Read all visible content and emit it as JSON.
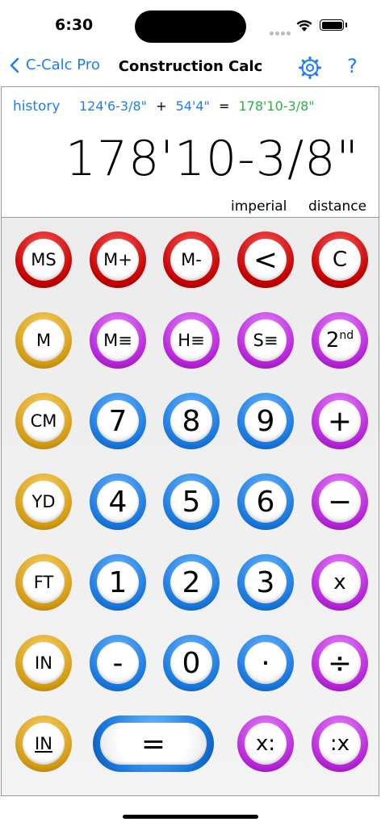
{
  "status": {
    "time": "6:30"
  },
  "nav": {
    "back_label": "C-Calc Pro",
    "title": "Construction Calc",
    "help_label": "?"
  },
  "display": {
    "history_label": "history",
    "operand1": "124'6-3/8\"",
    "operator": "+",
    "operand2": "54'4\"",
    "equals": "=",
    "result_small": "178'10-3/8\"",
    "main_value": "178'10-3/8\"",
    "mode_units": "imperial",
    "mode_type": "distance"
  },
  "keys": {
    "ms": "MS",
    "mplus": "M+",
    "mminus": "M-",
    "back": "<",
    "clear": "C",
    "m": "M",
    "mlist": "M≡",
    "hlist": "H≡",
    "slist": "S≡",
    "second": "2",
    "second_sup": "nd",
    "cm": "CM",
    "k7": "7",
    "k8": "8",
    "k9": "9",
    "plus": "+",
    "yd": "YD",
    "k4": "4",
    "k5": "5",
    "k6": "6",
    "minus": "−",
    "ft": "FT",
    "k1": "1",
    "k2": "2",
    "k3": "3",
    "times": "x",
    "in": "IN",
    "neg": "-",
    "k0": "0",
    "dot": "·",
    "divide": "÷",
    "in_frac": "IN",
    "equals": "=",
    "xcolon": "x:",
    "colonx": ":x"
  },
  "colors": {
    "accent": "#1a7ef2",
    "result_green": "#27b043"
  }
}
